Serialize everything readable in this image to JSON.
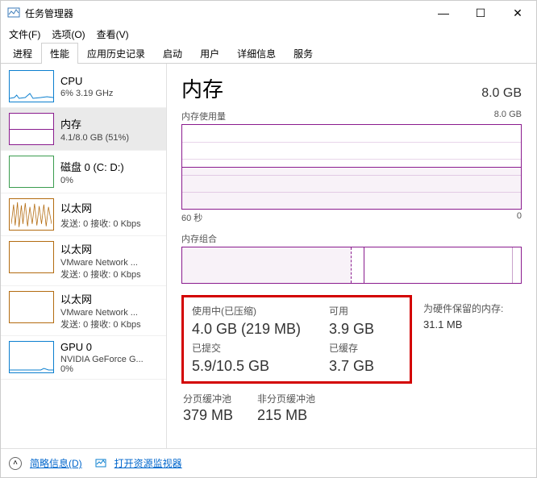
{
  "window": {
    "title": "任务管理器",
    "buttons": {
      "min": "—",
      "max": "☐",
      "close": "✕"
    }
  },
  "menu": {
    "file": "文件(F)",
    "options": "选项(O)",
    "view": "查看(V)"
  },
  "tabs": {
    "processes": "进程",
    "performance": "性能",
    "history": "应用历史记录",
    "startup": "启动",
    "users": "用户",
    "details": "详细信息",
    "services": "服务"
  },
  "sidebar": {
    "cpu": {
      "title": "CPU",
      "sub": "6%  3.19 GHz"
    },
    "memory": {
      "title": "内存",
      "sub": "4.1/8.0 GB (51%)"
    },
    "disk": {
      "title": "磁盘 0 (C: D:)",
      "sub": "0%"
    },
    "eth0": {
      "title": "以太网",
      "sub": "发送: 0 接收: 0 Kbps"
    },
    "eth1": {
      "title": "以太网",
      "sub1": "VMware Network ...",
      "sub2": "发送: 0 接收: 0 Kbps"
    },
    "eth2": {
      "title": "以太网",
      "sub1": "VMware Network ...",
      "sub2": "发送: 0 接收: 0 Kbps"
    },
    "gpu": {
      "title": "GPU 0",
      "sub1": "NVIDIA GeForce G...",
      "sub2": "0%"
    }
  },
  "main": {
    "title": "内存",
    "total": "8.0 GB",
    "usage_label": "内存使用量",
    "usage_max": "8.0 GB",
    "axis_left": "60 秒",
    "axis_right": "0",
    "comp_label": "内存组合",
    "stats": {
      "in_use_label": "使用中(已压缩)",
      "in_use_value": "4.0 GB (219 MB)",
      "avail_label": "可用",
      "avail_value": "3.9 GB",
      "commit_label": "已提交",
      "commit_value": "5.9/10.5 GB",
      "cached_label": "已缓存",
      "cached_value": "3.7 GB"
    },
    "reserved": {
      "label": "为硬件保留的内存:",
      "value": "31.1 MB"
    },
    "pools": {
      "paged_label": "分页缓冲池",
      "paged_value": "379 MB",
      "nonpaged_label": "非分页缓冲池",
      "nonpaged_value": "215 MB"
    }
  },
  "footer": {
    "fewer": "简略信息(D)",
    "monitor": "打开资源监视器"
  },
  "chart_data": {
    "type": "line",
    "title": "内存使用量",
    "xlabel": "60 秒",
    "ylabel": "GB",
    "ylim": [
      0,
      8.0
    ],
    "x": [
      60,
      55,
      50,
      45,
      40,
      35,
      30,
      25,
      20,
      15,
      10,
      5,
      0
    ],
    "series": [
      {
        "name": "内存使用量",
        "values": [
          4.1,
          4.1,
          4.1,
          4.1,
          4.1,
          4.1,
          4.1,
          4.1,
          4.1,
          4.1,
          4.1,
          4.1,
          4.1
        ]
      }
    ]
  }
}
